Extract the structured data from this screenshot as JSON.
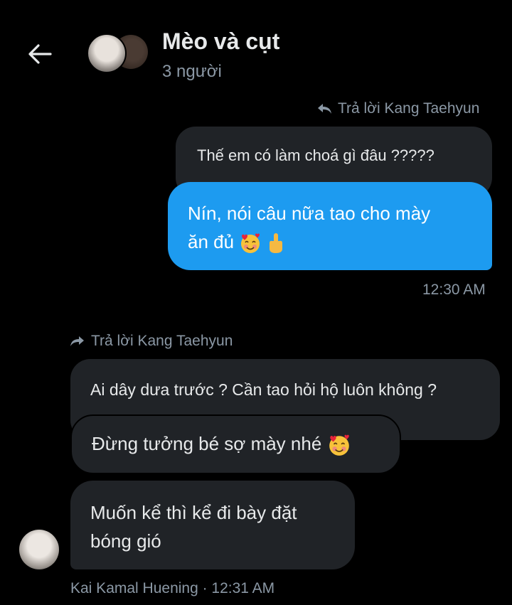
{
  "header": {
    "title": "Mèo và cụt",
    "subtitle": "3 người"
  },
  "colors": {
    "background": "#000000",
    "sent_bubble": "#1d9bf0",
    "received_bubble": "#202327",
    "muted_text": "#8b98a5"
  },
  "messages": {
    "sent_reply_label": "Trả lời Kang Taehyun",
    "quoted_sent": "Thế em có làm choá gì đâu ?????",
    "sent_line1": "Nín, nói câu nữa tao cho mày",
    "sent_line2": "ăn đủ",
    "sent_time": "12:30 AM",
    "recv_reply_label": "Trả lời Kang Taehyun",
    "quoted_recv": "Ai dây dưa trước ? Cần tao hỏi hộ luôn không ?",
    "recv1": "Đừng tưởng bé sợ mày nhé",
    "recv2_line1": "Muốn kể thì kể đi bày đặt",
    "recv2_line2": "bóng gió",
    "recv_meta": "Kai Kamal Huening · 12:31 AM"
  },
  "icons": {
    "back": "arrow-left-icon",
    "reply_sent": "reply-arrow-icon",
    "reply_recv": "forward-arrow-icon",
    "emoji_love": "smiling-face-with-hearts-icon",
    "emoji_finger": "middle-finger-icon"
  }
}
